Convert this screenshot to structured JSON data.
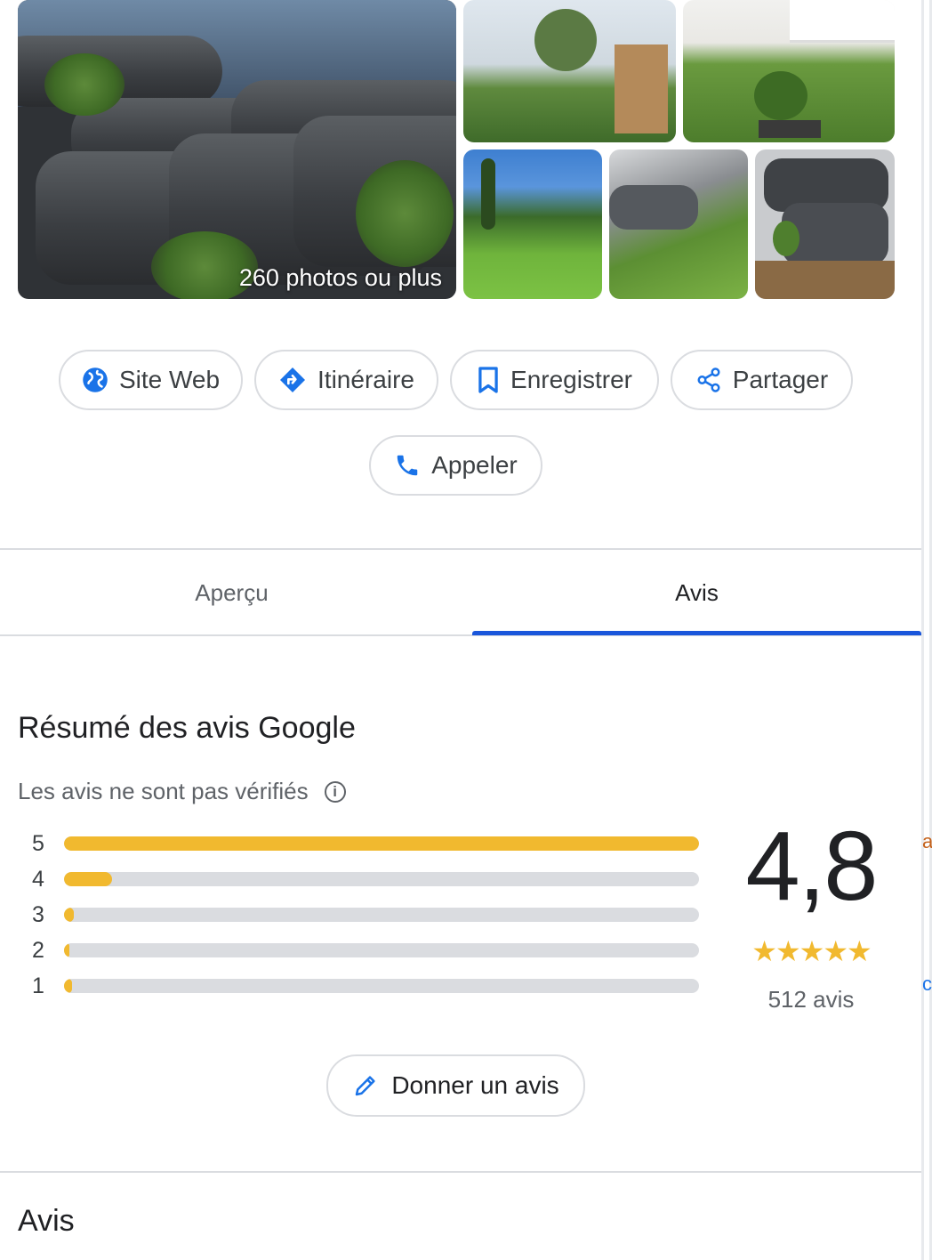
{
  "photos": {
    "count_label": "260 photos ou plus"
  },
  "actions": {
    "website": "Site Web",
    "directions": "Itinéraire",
    "save": "Enregistrer",
    "share": "Partager",
    "call": "Appeler"
  },
  "tabs": {
    "overview": "Aperçu",
    "reviews": "Avis",
    "active": "reviews"
  },
  "summary": {
    "title": "Résumé des avis Google",
    "unverified_note": "Les avis ne sont pas vérifiés",
    "distribution": [
      {
        "stars": "5",
        "fraction": 1.0
      },
      {
        "stars": "4",
        "fraction": 0.075
      },
      {
        "stars": "3",
        "fraction": 0.016
      },
      {
        "stars": "2",
        "fraction": 0.007
      },
      {
        "stars": "1",
        "fraction": 0.013
      }
    ],
    "rating": "4,8",
    "stars_glyphs": "★★★★★",
    "review_count": "512 avis",
    "write_review": "Donner un avis"
  },
  "reviews_section": {
    "title": "Avis"
  },
  "colors": {
    "accent": "#1a73e8",
    "tab_indicator": "#1a56db",
    "star_bar": "#f1b92f",
    "track": "#dadce0"
  },
  "icons": [
    "globe-icon",
    "directions-icon",
    "bookmark-icon",
    "share-icon",
    "phone-icon",
    "info-icon",
    "pencil-icon"
  ]
}
